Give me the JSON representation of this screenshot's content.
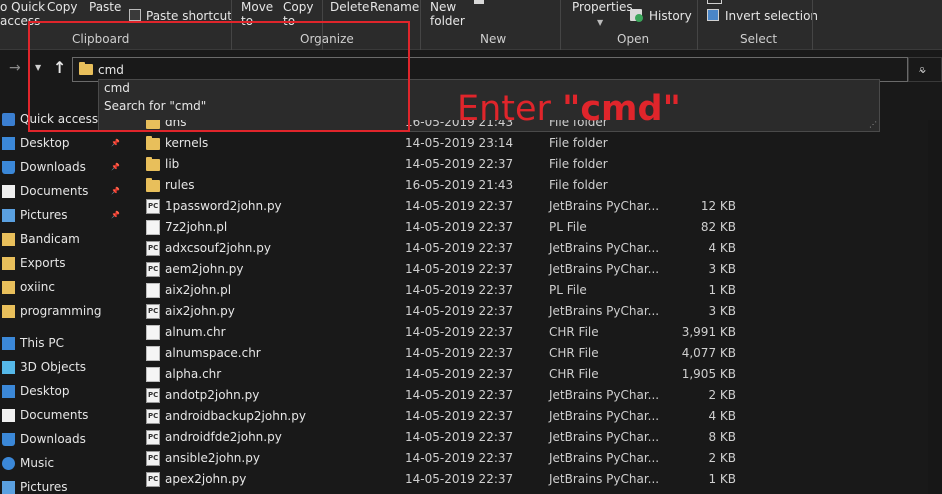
{
  "ribbon": {
    "quick_access_line1": "o Quick",
    "quick_access_line2": "access",
    "copy": "Copy",
    "paste": "Paste",
    "paste_shortcut": "Paste shortcut",
    "move_to_line1": "Move",
    "move_to_line2": "to",
    "copy_to_line1": "Copy",
    "copy_to_line2": "to",
    "delete": "Delete",
    "rename": "Rename",
    "new_folder_line1": "New",
    "new_folder_line2": "folder",
    "properties": "Properties",
    "history": "History",
    "invert_selection": "Invert selection",
    "groups": {
      "clipboard": "Clipboard",
      "organize": "Organize",
      "new": "New",
      "open": "Open",
      "select": "Select"
    }
  },
  "address": {
    "value": "cmd",
    "suggestions": [
      "cmd",
      "Search for \"cmd\""
    ]
  },
  "annotation": {
    "prefix": "Enter ",
    "quoted": "\"cmd\"",
    "color": "#e0252b"
  },
  "sidebar": {
    "items": [
      {
        "label": "Quick access",
        "icon": "star-icon",
        "pinned": false
      },
      {
        "label": "Desktop",
        "icon": "desktop-icon",
        "pinned": true
      },
      {
        "label": "Downloads",
        "icon": "download-icon",
        "pinned": true
      },
      {
        "label": "Documents",
        "icon": "document-icon",
        "pinned": true
      },
      {
        "label": "Pictures",
        "icon": "pictures-icon",
        "pinned": true
      },
      {
        "label": "Bandicam",
        "icon": "folder-icon",
        "pinned": false
      },
      {
        "label": "Exports",
        "icon": "folder-icon",
        "pinned": false
      },
      {
        "label": "oxiinc",
        "icon": "folder-icon",
        "pinned": false
      },
      {
        "label": "programming",
        "icon": "folder-icon",
        "pinned": false
      },
      {
        "label": "This PC",
        "icon": "pc-icon",
        "pinned": false
      },
      {
        "label": "3D Objects",
        "icon": "cube-icon",
        "pinned": false
      },
      {
        "label": "Desktop",
        "icon": "desktop-icon",
        "pinned": false
      },
      {
        "label": "Documents",
        "icon": "document-icon",
        "pinned": false
      },
      {
        "label": "Downloads",
        "icon": "download-icon",
        "pinned": false
      },
      {
        "label": "Music",
        "icon": "music-icon",
        "pinned": false
      },
      {
        "label": "Pictures",
        "icon": "pictures-icon",
        "pinned": false
      }
    ]
  },
  "files": [
    {
      "name": "dns",
      "date": "16-05-2019 21:43",
      "type": "File folder",
      "size": "",
      "kind": "folder"
    },
    {
      "name": "kernels",
      "date": "14-05-2019 23:14",
      "type": "File folder",
      "size": "",
      "kind": "folder"
    },
    {
      "name": "lib",
      "date": "14-05-2019 22:37",
      "type": "File folder",
      "size": "",
      "kind": "folder"
    },
    {
      "name": "rules",
      "date": "16-05-2019 21:43",
      "type": "File folder",
      "size": "",
      "kind": "folder"
    },
    {
      "name": "1password2john.py",
      "date": "14-05-2019 22:37",
      "type": "JetBrains PyChar...",
      "size": "12 KB",
      "kind": "py"
    },
    {
      "name": "7z2john.pl",
      "date": "14-05-2019 22:37",
      "type": "PL File",
      "size": "82 KB",
      "kind": "doc"
    },
    {
      "name": "adxcsouf2john.py",
      "date": "14-05-2019 22:37",
      "type": "JetBrains PyChar...",
      "size": "4 KB",
      "kind": "py"
    },
    {
      "name": "aem2john.py",
      "date": "14-05-2019 22:37",
      "type": "JetBrains PyChar...",
      "size": "3 KB",
      "kind": "py"
    },
    {
      "name": "aix2john.pl",
      "date": "14-05-2019 22:37",
      "type": "PL File",
      "size": "1 KB",
      "kind": "doc"
    },
    {
      "name": "aix2john.py",
      "date": "14-05-2019 22:37",
      "type": "JetBrains PyChar...",
      "size": "3 KB",
      "kind": "py"
    },
    {
      "name": "alnum.chr",
      "date": "14-05-2019 22:37",
      "type": "CHR File",
      "size": "3,991 KB",
      "kind": "doc"
    },
    {
      "name": "alnumspace.chr",
      "date": "14-05-2019 22:37",
      "type": "CHR File",
      "size": "4,077 KB",
      "kind": "doc"
    },
    {
      "name": "alpha.chr",
      "date": "14-05-2019 22:37",
      "type": "CHR File",
      "size": "1,905 KB",
      "kind": "doc"
    },
    {
      "name": "andotp2john.py",
      "date": "14-05-2019 22:37",
      "type": "JetBrains PyChar...",
      "size": "2 KB",
      "kind": "py"
    },
    {
      "name": "androidbackup2john.py",
      "date": "14-05-2019 22:37",
      "type": "JetBrains PyChar...",
      "size": "4 KB",
      "kind": "py"
    },
    {
      "name": "androidfde2john.py",
      "date": "14-05-2019 22:37",
      "type": "JetBrains PyChar...",
      "size": "8 KB",
      "kind": "py"
    },
    {
      "name": "ansible2john.py",
      "date": "14-05-2019 22:37",
      "type": "JetBrains PyChar...",
      "size": "2 KB",
      "kind": "py"
    },
    {
      "name": "apex2john.py",
      "date": "14-05-2019 22:37",
      "type": "JetBrains PyChar...",
      "size": "1 KB",
      "kind": "py"
    }
  ]
}
